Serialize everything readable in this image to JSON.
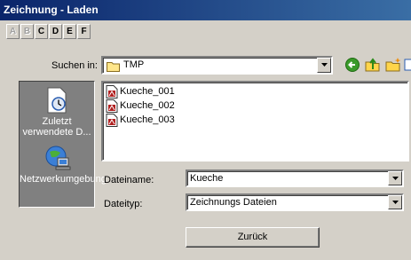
{
  "window": {
    "title": "Zeichnung - Laden"
  },
  "drives": [
    "A",
    "B",
    "C",
    "D",
    "E",
    "F"
  ],
  "look_in": {
    "label": "Suchen in:",
    "value": "TMP"
  },
  "places": [
    {
      "label": "Zuletzt verwendete D...",
      "icon": "recent-documents-icon"
    },
    {
      "label": "Netzwerkumgebung",
      "icon": "network-icon"
    }
  ],
  "files": [
    "Kueche_001",
    "Kueche_002",
    "Kueche_003"
  ],
  "filename": {
    "label": "Dateiname:",
    "value": "Kueche"
  },
  "filetype": {
    "label": "Dateityp:",
    "value": "Zeichnungs Dateien"
  },
  "buttons": {
    "back": "Zurück"
  },
  "colors": {
    "title_start": "#0a246a",
    "title_end": "#3a6ea5",
    "face": "#d4d0c8",
    "places_bg": "#808080"
  }
}
